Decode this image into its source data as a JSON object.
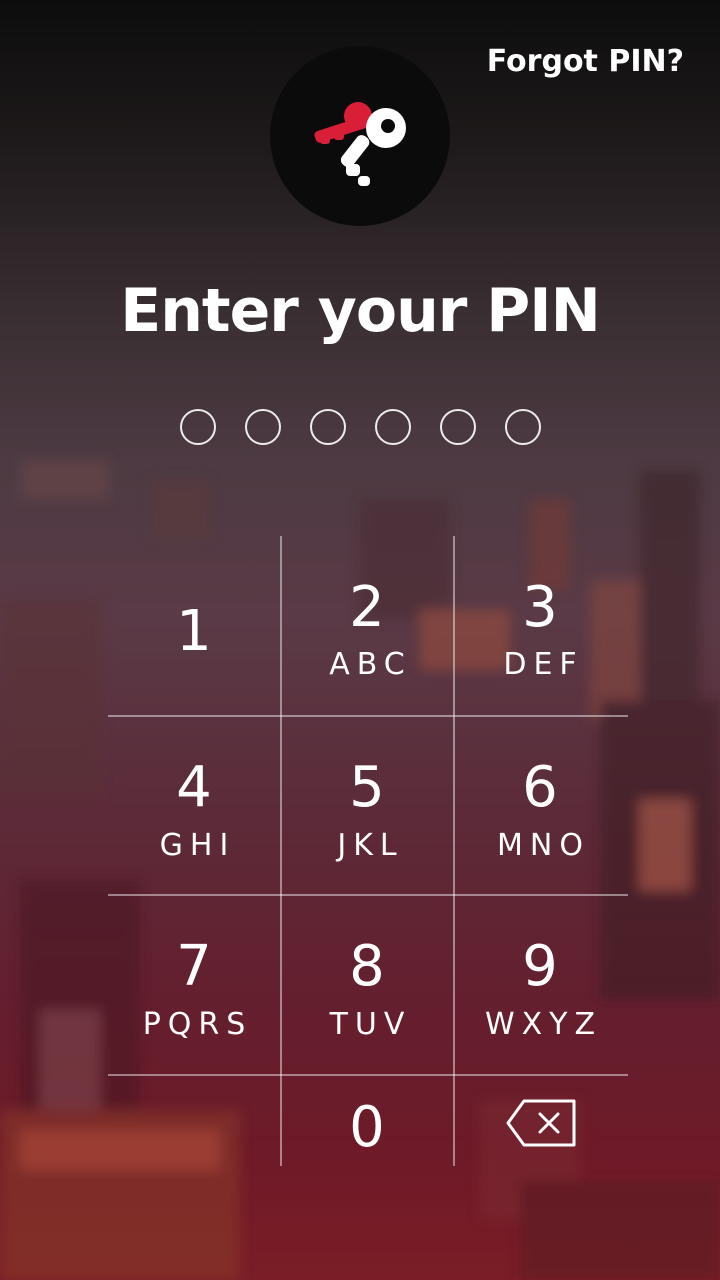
{
  "header": {
    "forgot_label": "Forgot PIN?"
  },
  "logo": {
    "icon": "key-icon",
    "accent_color": "#d81f37"
  },
  "title": "Enter your PIN",
  "pin": {
    "length": 6,
    "entered": 0
  },
  "keypad": {
    "keys": [
      {
        "digit": "1",
        "letters": ""
      },
      {
        "digit": "2",
        "letters": "ABC"
      },
      {
        "digit": "3",
        "letters": "DEF"
      },
      {
        "digit": "4",
        "letters": "GHI"
      },
      {
        "digit": "5",
        "letters": "JKL"
      },
      {
        "digit": "6",
        "letters": "MNO"
      },
      {
        "digit": "7",
        "letters": "PQRS"
      },
      {
        "digit": "8",
        "letters": "TUV"
      },
      {
        "digit": "9",
        "letters": "WXYZ"
      },
      {
        "digit": "0",
        "letters": ""
      }
    ],
    "backspace_icon": "backspace-icon"
  }
}
